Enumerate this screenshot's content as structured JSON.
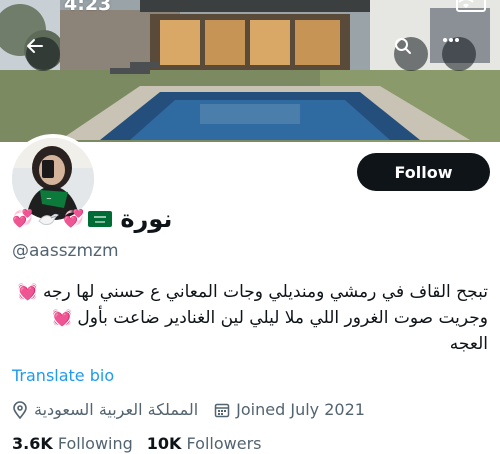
{
  "status_bar": {
    "time": "4:23"
  },
  "profile": {
    "display_name": "نورة",
    "handle": "@aasszmzm",
    "follow_label": "Follow",
    "bio_lines": [
      "تبجح القاف في رمشي ومنديلي وجات المعاني ع حسني لها رجه",
      "وجريت صوت الغرور اللي ملا ليلي لين الغنادير ضاعت بأول",
      "العجه"
    ],
    "translate_label": "Translate bio",
    "location": "المملكة العربية السعودية",
    "joined": "Joined July 2021",
    "following_count": "3.6K",
    "following_label": "Following",
    "followers_count": "10K",
    "followers_label": "Followers"
  },
  "icons": {
    "back": "back-arrow-icon",
    "search": "search-icon",
    "more": "more-icon",
    "location": "location-pin-icon",
    "calendar": "calendar-icon"
  },
  "colors": {
    "accent": "#1d9bf0",
    "text": "#0f1419",
    "muted": "#536471",
    "heart": "#ff5fb4",
    "flag_green": "#006c35"
  }
}
